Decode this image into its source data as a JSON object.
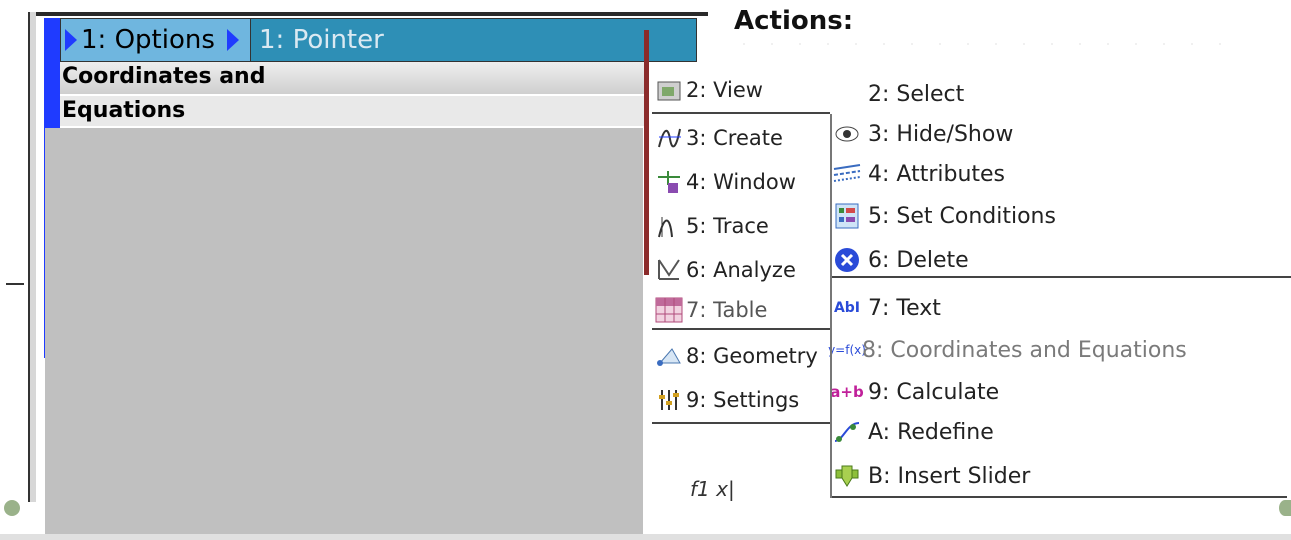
{
  "left_panel": {
    "tabs": [
      {
        "label": "1: Options"
      },
      {
        "label": "1: Pointer"
      }
    ],
    "breadcrumb": "Coordinates and",
    "breadcrumb2": "Equations"
  },
  "actions_menu": {
    "title": "Actions:",
    "items": [
      {
        "label": "2: View",
        "icon": "view-icon"
      },
      {
        "label": "3: Create",
        "icon": "graph-create-icon"
      },
      {
        "label": "4: Window",
        "icon": "window-zoom-icon"
      },
      {
        "label": "5: Trace",
        "icon": "trace-icon"
      },
      {
        "label": "6: Analyze",
        "icon": "analyze-icon"
      },
      {
        "label": "7: Table",
        "icon": "table-icon"
      },
      {
        "label": "8: Geometry",
        "icon": "geometry-icon"
      },
      {
        "label": "9: Settings",
        "icon": "settings-icon"
      }
    ]
  },
  "submenu": {
    "items": [
      {
        "label": "2: Select",
        "icon": ""
      },
      {
        "label": "3: Hide/Show",
        "icon": "eye-icon"
      },
      {
        "label": "4: Attributes",
        "icon": "attributes-icon"
      },
      {
        "label": "5: Set Conditions",
        "icon": "conditions-icon"
      },
      {
        "label": "6: Delete",
        "icon": "delete-icon"
      },
      {
        "label": "7: Text",
        "icon": "text-icon"
      },
      {
        "label": "8: Coordinates and Equations",
        "icon": "coordinates-equation-icon"
      },
      {
        "label": "9: Calculate",
        "icon": "calculate-icon"
      },
      {
        "label": "A: Redefine",
        "icon": "redefine-icon"
      },
      {
        "label": "B: Insert Slider",
        "icon": "slider-icon"
      }
    ]
  },
  "entry_line": {
    "text": "f1 x|"
  },
  "colors": {
    "accent_blue": "#1f3bff",
    "tab_light": "#6fb6df",
    "tab_dark": "#2e8fb6",
    "gray_area": "#c0c0c0"
  }
}
